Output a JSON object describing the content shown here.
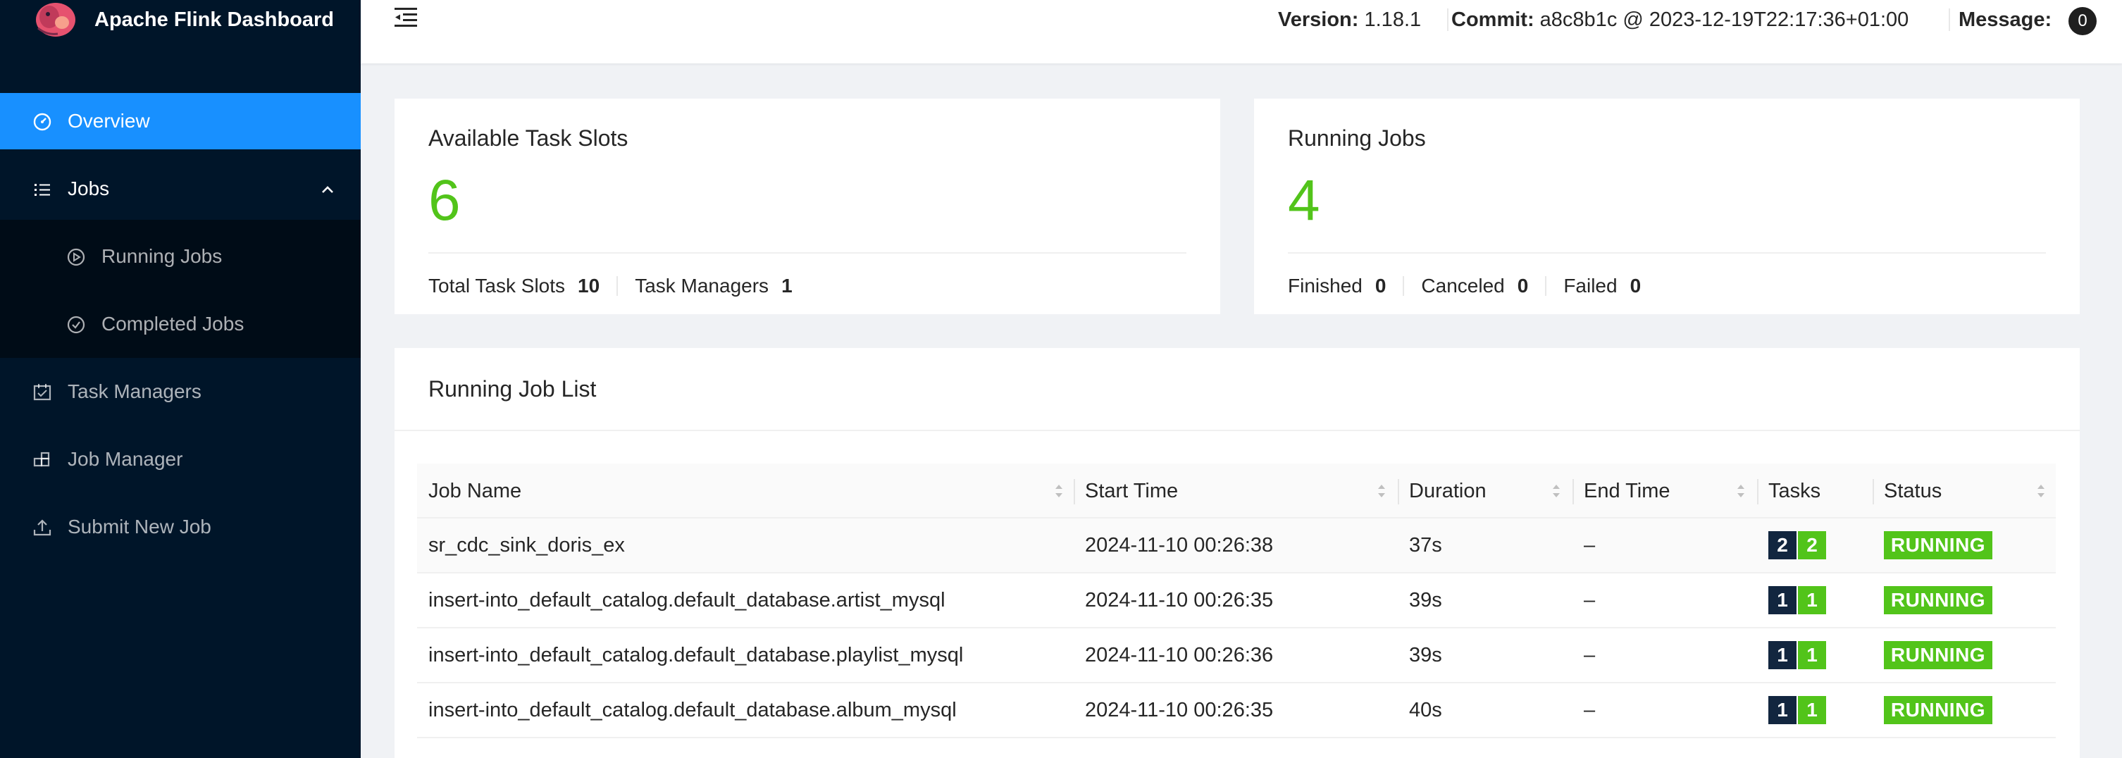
{
  "app": {
    "title": "Apache Flink Dashboard"
  },
  "sidebar": {
    "items": [
      {
        "label": "Overview",
        "icon": "dashboard-icon"
      },
      {
        "label": "Jobs",
        "icon": "unordered-list-icon"
      },
      {
        "label": "Running Jobs",
        "icon": "play-circle-icon"
      },
      {
        "label": "Completed Jobs",
        "icon": "check-circle-icon"
      },
      {
        "label": "Task Managers",
        "icon": "schedule-icon"
      },
      {
        "label": "Job Manager",
        "icon": "build-icon"
      },
      {
        "label": "Submit New Job",
        "icon": "upload-icon"
      }
    ]
  },
  "header": {
    "version_label": "Version:",
    "version_value": "1.18.1",
    "commit_label": "Commit:",
    "commit_value": "a8c8b1c @ 2023-12-19T22:17:36+01:00",
    "message_label": "Message:",
    "message_count": "0"
  },
  "slots_card": {
    "title": "Available Task Slots",
    "value": "6",
    "total_label": "Total Task Slots",
    "total_value": "10",
    "tm_label": "Task Managers",
    "tm_value": "1"
  },
  "jobs_card": {
    "title": "Running Jobs",
    "value": "4",
    "finished_label": "Finished",
    "finished_value": "0",
    "canceled_label": "Canceled",
    "canceled_value": "0",
    "failed_label": "Failed",
    "failed_value": "0"
  },
  "job_list": {
    "title": "Running Job List",
    "columns": [
      "Job Name",
      "Start Time",
      "Duration",
      "End Time",
      "Tasks",
      "Status"
    ],
    "rows": [
      {
        "name": "sr_cdc_sink_doris_ex",
        "start": "2024-11-10 00:26:38",
        "duration": "37s",
        "end": "–",
        "tasks_total": "2",
        "tasks_running": "2",
        "status": "RUNNING"
      },
      {
        "name": "insert-into_default_catalog.default_database.artist_mysql",
        "start": "2024-11-10 00:26:35",
        "duration": "39s",
        "end": "–",
        "tasks_total": "1",
        "tasks_running": "1",
        "status": "RUNNING"
      },
      {
        "name": "insert-into_default_catalog.default_database.playlist_mysql",
        "start": "2024-11-10 00:26:36",
        "duration": "39s",
        "end": "–",
        "tasks_total": "1",
        "tasks_running": "1",
        "status": "RUNNING"
      },
      {
        "name": "insert-into_default_catalog.default_database.album_mysql",
        "start": "2024-11-10 00:26:35",
        "duration": "40s",
        "end": "–",
        "tasks_total": "1",
        "tasks_running": "1",
        "status": "RUNNING"
      }
    ]
  },
  "colors": {
    "sidebar_bg": "#001529",
    "active_blue": "#1890ff",
    "success_green": "#52c41a",
    "task_dark": "#12263f"
  }
}
